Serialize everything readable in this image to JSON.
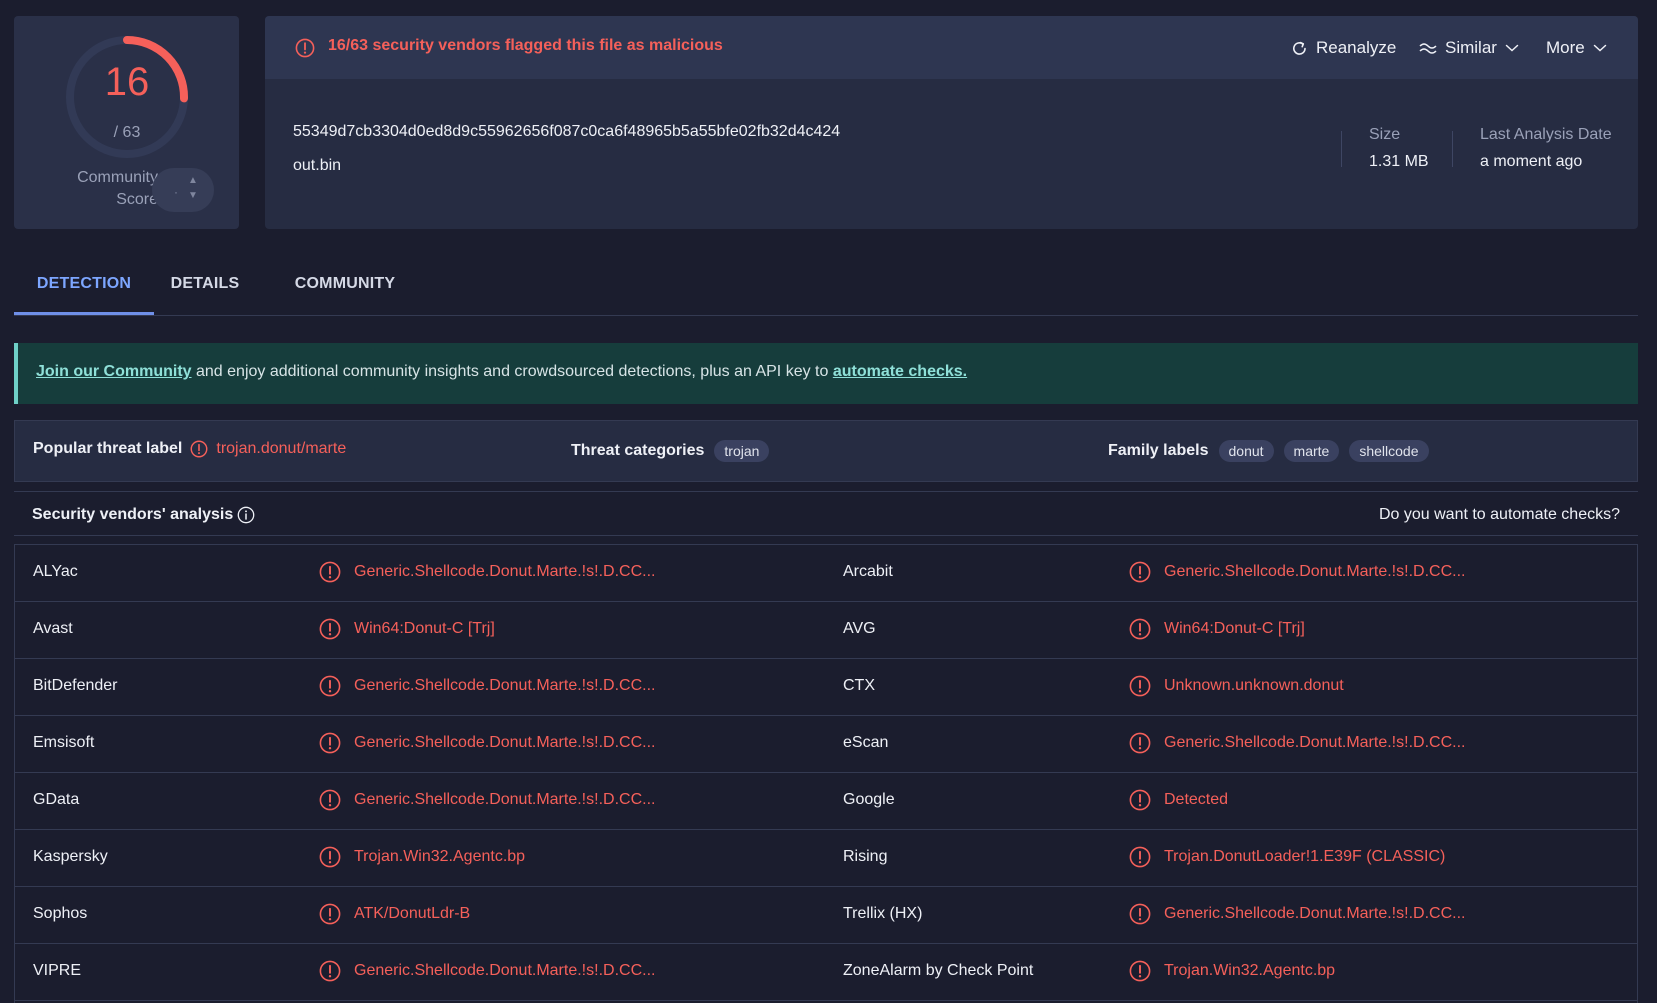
{
  "score": {
    "detections": "16",
    "total": "/ 63",
    "detections_count": 16,
    "total_count": 63,
    "community_label_line1": "Community",
    "community_label_line2": "Score",
    "vote_placeholder": "·"
  },
  "header": {
    "flag_text": "16/63 security vendors flagged this file as malicious",
    "actions": {
      "reanalyze": "Reanalyze",
      "similar": "Similar",
      "more": "More"
    }
  },
  "file": {
    "hash": "55349d7cb3304d0ed8d9c55962656f087c0ca6f48965b5a55bfe02fb32d4c424",
    "name": "out.bin",
    "size_label": "Size",
    "size_value": "1.31 MB",
    "date_label": "Last Analysis Date",
    "date_value": "a moment ago"
  },
  "tabs": [
    {
      "label": "DETECTION"
    },
    {
      "label": "DETAILS"
    },
    {
      "label": "COMMUNITY"
    }
  ],
  "banner": {
    "join_link": "Join our Community",
    "middle_text": " and enjoy additional community insights and crowdsourced detections, plus an API key to ",
    "automate_link": "automate checks."
  },
  "threat": {
    "popular_label": "Popular threat label",
    "popular_value": "trojan.donut/marte",
    "categories_label": "Threat categories",
    "categories": [
      "trojan"
    ],
    "family_label": "Family labels",
    "families": [
      "donut",
      "marte",
      "shellcode"
    ]
  },
  "vendors": {
    "title": "Security vendors' analysis",
    "automate_prompt": "Do you want to automate checks?",
    "rows": [
      {
        "v1": "ALYac",
        "r1": "Generic.Shellcode.Donut.Marte.!s!.D.CC...",
        "v2": "Arcabit",
        "r2": "Generic.Shellcode.Donut.Marte.!s!.D.CC..."
      },
      {
        "v1": "Avast",
        "r1": "Win64:Donut-C [Trj]",
        "v2": "AVG",
        "r2": "Win64:Donut-C [Trj]"
      },
      {
        "v1": "BitDefender",
        "r1": "Generic.Shellcode.Donut.Marte.!s!.D.CC...",
        "v2": "CTX",
        "r2": "Unknown.unknown.donut"
      },
      {
        "v1": "Emsisoft",
        "r1": "Generic.Shellcode.Donut.Marte.!s!.D.CC...",
        "v2": "eScan",
        "r2": "Generic.Shellcode.Donut.Marte.!s!.D.CC..."
      },
      {
        "v1": "GData",
        "r1": "Generic.Shellcode.Donut.Marte.!s!.D.CC...",
        "v2": "Google",
        "r2": "Detected"
      },
      {
        "v1": "Kaspersky",
        "r1": "Trojan.Win32.Agentc.bp",
        "v2": "Rising",
        "r2": "Trojan.DonutLoader!1.E39F (CLASSIC)"
      },
      {
        "v1": "Sophos",
        "r1": "ATK/DonutLdr-B",
        "v2": "Trellix (HX)",
        "r2": "Generic.Shellcode.Donut.Marte.!s!.D.CC..."
      },
      {
        "v1": "VIPRE",
        "r1": "Generic.Shellcode.Donut.Marte.!s!.D.CC...",
        "v2": "ZoneAlarm by Check Point",
        "r2": "Trojan.Win32.Agentc.bp"
      }
    ]
  },
  "colors": {
    "malicious": "#f5605a",
    "accent_tab": "#7da6ff",
    "banner_bg": "#163d3c",
    "page_bg": "#1b1d2e"
  },
  "icons": {
    "alert": "alert-circle-icon",
    "reanalyze": "refresh-icon",
    "similar": "wave-icon",
    "dropdown": "chevron-down-icon",
    "info": "info-icon"
  }
}
